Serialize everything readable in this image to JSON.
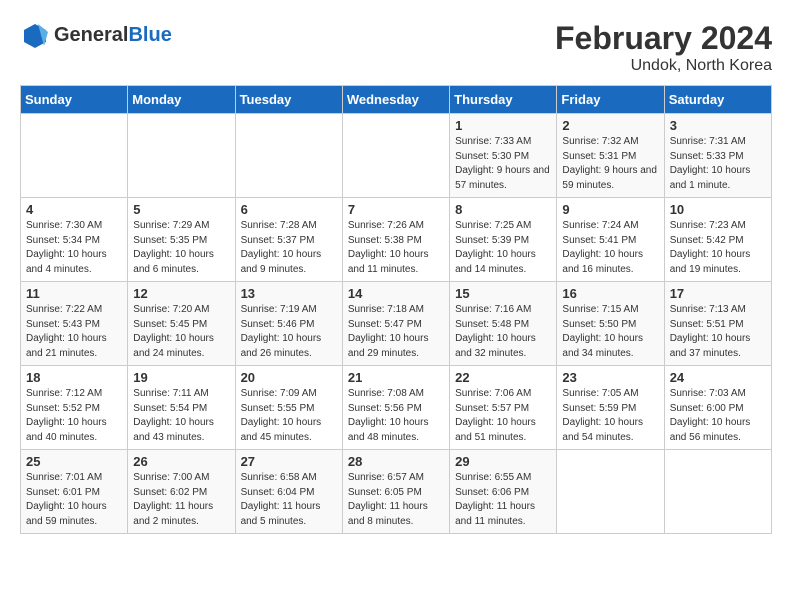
{
  "header": {
    "logo_general": "General",
    "logo_blue": "Blue",
    "title": "February 2024",
    "subtitle": "Undok, North Korea"
  },
  "weekdays": [
    "Sunday",
    "Monday",
    "Tuesday",
    "Wednesday",
    "Thursday",
    "Friday",
    "Saturday"
  ],
  "weeks": [
    [
      {
        "day": "",
        "content": ""
      },
      {
        "day": "",
        "content": ""
      },
      {
        "day": "",
        "content": ""
      },
      {
        "day": "",
        "content": ""
      },
      {
        "day": "1",
        "content": "Sunrise: 7:33 AM\nSunset: 5:30 PM\nDaylight: 9 hours and 57 minutes."
      },
      {
        "day": "2",
        "content": "Sunrise: 7:32 AM\nSunset: 5:31 PM\nDaylight: 9 hours and 59 minutes."
      },
      {
        "day": "3",
        "content": "Sunrise: 7:31 AM\nSunset: 5:33 PM\nDaylight: 10 hours and 1 minute."
      }
    ],
    [
      {
        "day": "4",
        "content": "Sunrise: 7:30 AM\nSunset: 5:34 PM\nDaylight: 10 hours and 4 minutes."
      },
      {
        "day": "5",
        "content": "Sunrise: 7:29 AM\nSunset: 5:35 PM\nDaylight: 10 hours and 6 minutes."
      },
      {
        "day": "6",
        "content": "Sunrise: 7:28 AM\nSunset: 5:37 PM\nDaylight: 10 hours and 9 minutes."
      },
      {
        "day": "7",
        "content": "Sunrise: 7:26 AM\nSunset: 5:38 PM\nDaylight: 10 hours and 11 minutes."
      },
      {
        "day": "8",
        "content": "Sunrise: 7:25 AM\nSunset: 5:39 PM\nDaylight: 10 hours and 14 minutes."
      },
      {
        "day": "9",
        "content": "Sunrise: 7:24 AM\nSunset: 5:41 PM\nDaylight: 10 hours and 16 minutes."
      },
      {
        "day": "10",
        "content": "Sunrise: 7:23 AM\nSunset: 5:42 PM\nDaylight: 10 hours and 19 minutes."
      }
    ],
    [
      {
        "day": "11",
        "content": "Sunrise: 7:22 AM\nSunset: 5:43 PM\nDaylight: 10 hours and 21 minutes."
      },
      {
        "day": "12",
        "content": "Sunrise: 7:20 AM\nSunset: 5:45 PM\nDaylight: 10 hours and 24 minutes."
      },
      {
        "day": "13",
        "content": "Sunrise: 7:19 AM\nSunset: 5:46 PM\nDaylight: 10 hours and 26 minutes."
      },
      {
        "day": "14",
        "content": "Sunrise: 7:18 AM\nSunset: 5:47 PM\nDaylight: 10 hours and 29 minutes."
      },
      {
        "day": "15",
        "content": "Sunrise: 7:16 AM\nSunset: 5:48 PM\nDaylight: 10 hours and 32 minutes."
      },
      {
        "day": "16",
        "content": "Sunrise: 7:15 AM\nSunset: 5:50 PM\nDaylight: 10 hours and 34 minutes."
      },
      {
        "day": "17",
        "content": "Sunrise: 7:13 AM\nSunset: 5:51 PM\nDaylight: 10 hours and 37 minutes."
      }
    ],
    [
      {
        "day": "18",
        "content": "Sunrise: 7:12 AM\nSunset: 5:52 PM\nDaylight: 10 hours and 40 minutes."
      },
      {
        "day": "19",
        "content": "Sunrise: 7:11 AM\nSunset: 5:54 PM\nDaylight: 10 hours and 43 minutes."
      },
      {
        "day": "20",
        "content": "Sunrise: 7:09 AM\nSunset: 5:55 PM\nDaylight: 10 hours and 45 minutes."
      },
      {
        "day": "21",
        "content": "Sunrise: 7:08 AM\nSunset: 5:56 PM\nDaylight: 10 hours and 48 minutes."
      },
      {
        "day": "22",
        "content": "Sunrise: 7:06 AM\nSunset: 5:57 PM\nDaylight: 10 hours and 51 minutes."
      },
      {
        "day": "23",
        "content": "Sunrise: 7:05 AM\nSunset: 5:59 PM\nDaylight: 10 hours and 54 minutes."
      },
      {
        "day": "24",
        "content": "Sunrise: 7:03 AM\nSunset: 6:00 PM\nDaylight: 10 hours and 56 minutes."
      }
    ],
    [
      {
        "day": "25",
        "content": "Sunrise: 7:01 AM\nSunset: 6:01 PM\nDaylight: 10 hours and 59 minutes."
      },
      {
        "day": "26",
        "content": "Sunrise: 7:00 AM\nSunset: 6:02 PM\nDaylight: 11 hours and 2 minutes."
      },
      {
        "day": "27",
        "content": "Sunrise: 6:58 AM\nSunset: 6:04 PM\nDaylight: 11 hours and 5 minutes."
      },
      {
        "day": "28",
        "content": "Sunrise: 6:57 AM\nSunset: 6:05 PM\nDaylight: 11 hours and 8 minutes."
      },
      {
        "day": "29",
        "content": "Sunrise: 6:55 AM\nSunset: 6:06 PM\nDaylight: 11 hours and 11 minutes."
      },
      {
        "day": "",
        "content": ""
      },
      {
        "day": "",
        "content": ""
      }
    ]
  ]
}
